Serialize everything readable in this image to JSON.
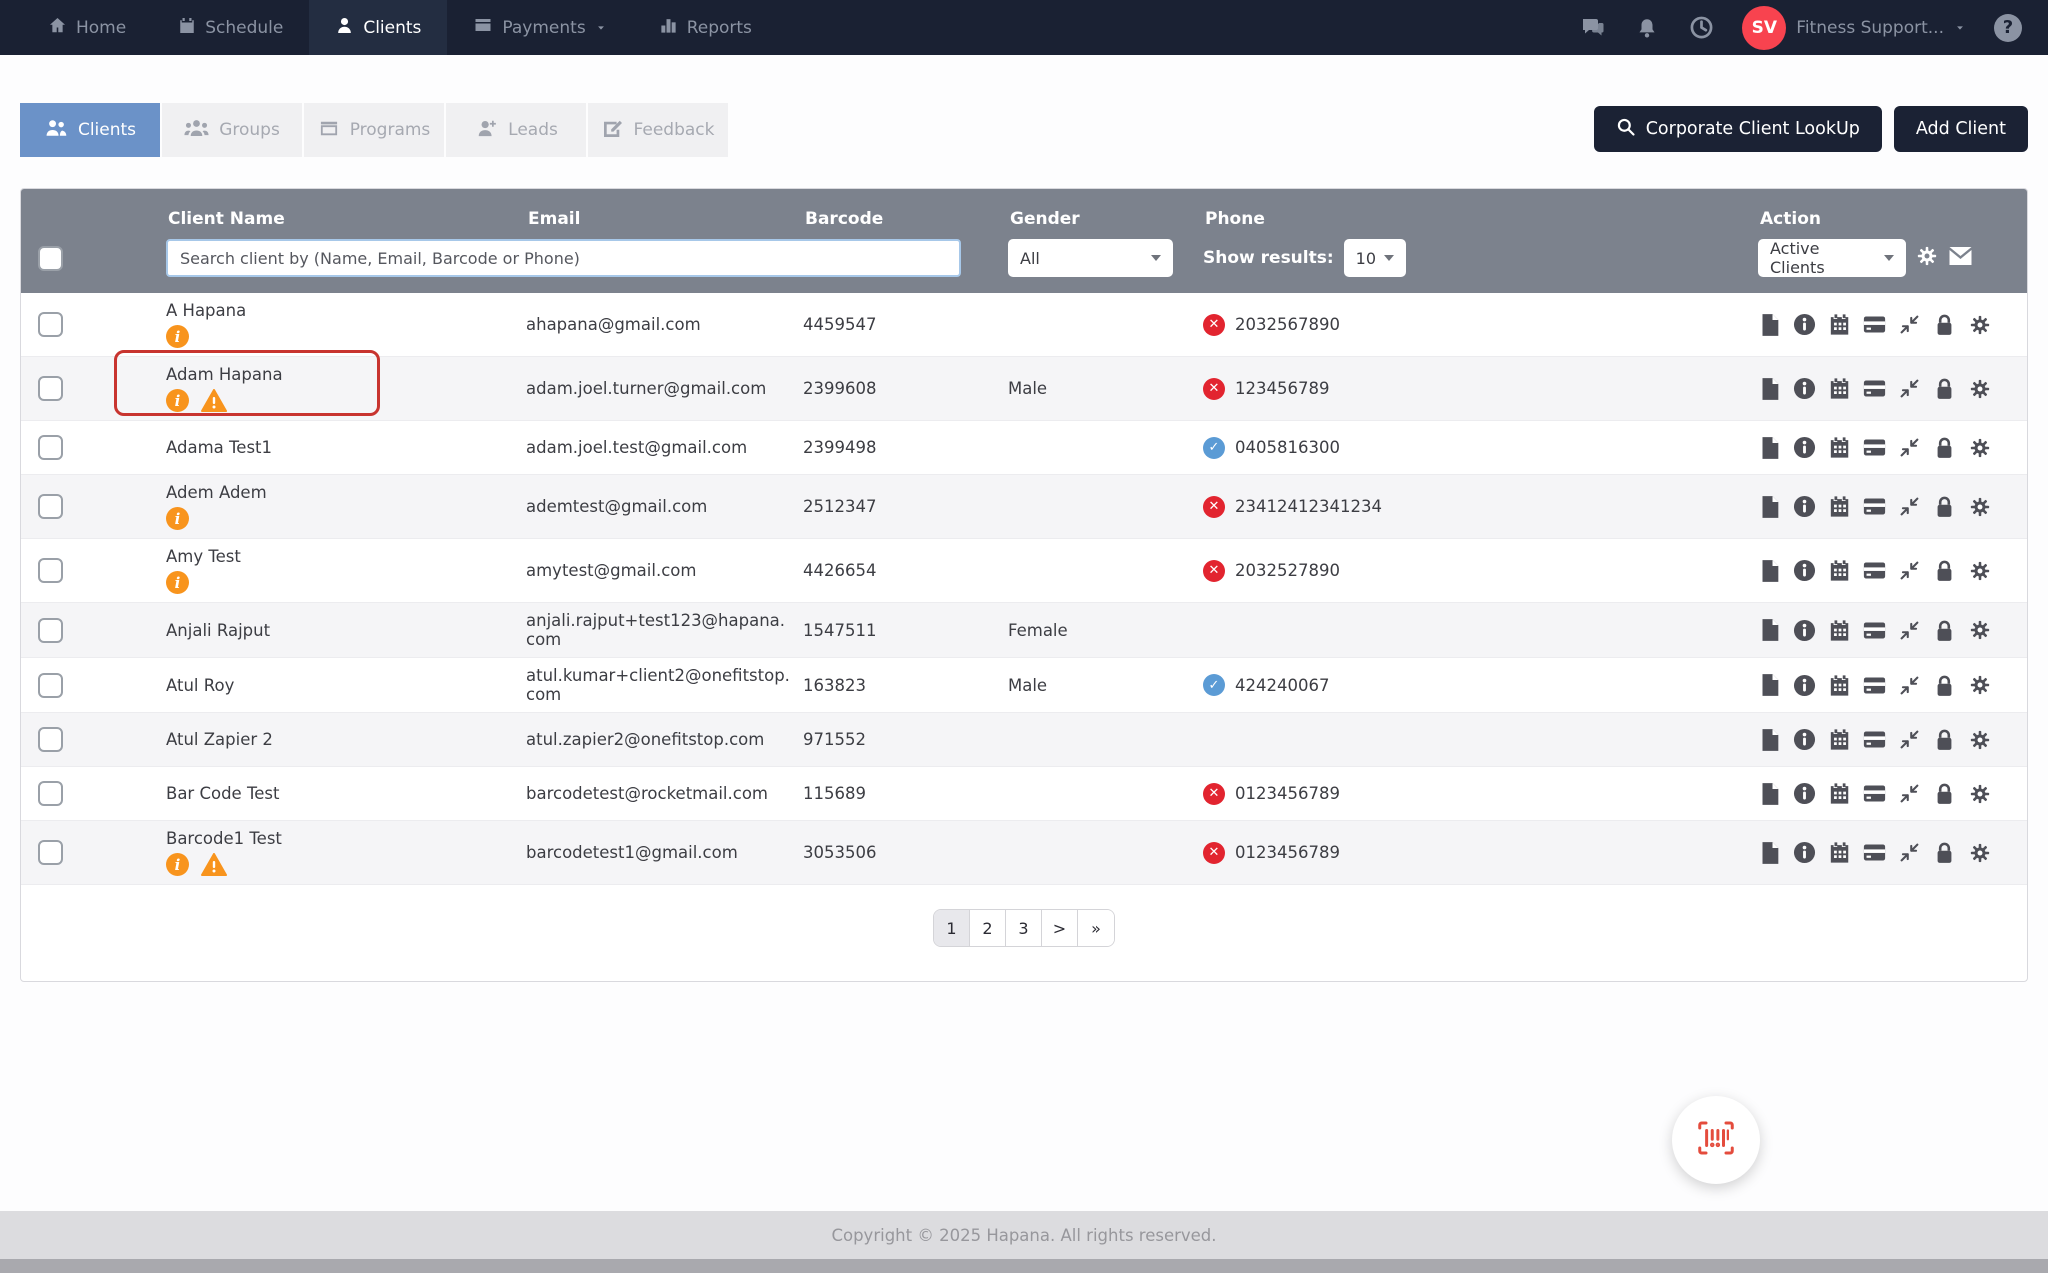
{
  "navbar": {
    "items": [
      {
        "label": "Home",
        "icon": "home-icon",
        "active": false
      },
      {
        "label": "Schedule",
        "icon": "schedule-icon",
        "active": false
      },
      {
        "label": "Clients",
        "icon": "clients-icon",
        "active": true
      },
      {
        "label": "Payments",
        "icon": "payments-icon",
        "active": false,
        "has_caret": true
      },
      {
        "label": "Reports",
        "icon": "reports-icon",
        "active": false
      }
    ],
    "right": {
      "avatar_initials": "SV",
      "account_name": "Fitness Support..."
    }
  },
  "tabs": [
    {
      "label": "Clients",
      "icon": "clients-tab-icon",
      "active": true
    },
    {
      "label": "Groups",
      "icon": "groups-tab-icon",
      "active": false
    },
    {
      "label": "Programs",
      "icon": "programs-tab-icon",
      "active": false
    },
    {
      "label": "Leads",
      "icon": "leads-tab-icon",
      "active": false
    },
    {
      "label": "Feedback",
      "icon": "feedback-tab-icon",
      "active": false
    }
  ],
  "toolbar": {
    "corporate_lookup_label": "Corporate Client LookUp",
    "add_client_label": "Add Client"
  },
  "table": {
    "headers": {
      "client_name": "Client Name",
      "email": "Email",
      "barcode": "Barcode",
      "gender": "Gender",
      "phone": "Phone",
      "action": "Action"
    },
    "filters": {
      "search_placeholder": "Search client by (Name, Email, Barcode or Phone)",
      "gender_value": "All",
      "show_results_label": "Show results:",
      "show_results_value": "10",
      "action_filter_value": "Active Clients"
    },
    "row_actions": [
      "file-icon",
      "info-circle-icon",
      "calendar-icon",
      "credit-card-icon",
      "compress-icon",
      "lock-icon",
      "gear-icon"
    ],
    "rows": [
      {
        "name": "A Hapana",
        "info": true,
        "warning": false,
        "highlighted": false,
        "email": "ahapana@gmail.com",
        "barcode": "4459547",
        "gender": "",
        "phone": "2032567890",
        "phone_status": "invalid"
      },
      {
        "name": "Adam Hapana",
        "info": true,
        "warning": true,
        "highlighted": true,
        "email": "adam.joel.turner@gmail.com",
        "barcode": "2399608",
        "gender": "Male",
        "phone": "123456789",
        "phone_status": "invalid"
      },
      {
        "name": "Adama Test1",
        "info": false,
        "warning": false,
        "highlighted": false,
        "email": "adam.joel.test@gmail.com",
        "barcode": "2399498",
        "gender": "",
        "phone": "0405816300",
        "phone_status": "verified"
      },
      {
        "name": "Adem Adem",
        "info": true,
        "warning": false,
        "highlighted": false,
        "email": "ademtest@gmail.com",
        "barcode": "2512347",
        "gender": "",
        "phone": "23412412341234",
        "phone_status": "invalid"
      },
      {
        "name": "Amy Test",
        "info": true,
        "warning": false,
        "highlighted": false,
        "email": "amytest@gmail.com",
        "barcode": "4426654",
        "gender": "",
        "phone": "2032527890",
        "phone_status": "invalid"
      },
      {
        "name": "Anjali Rajput",
        "info": false,
        "warning": false,
        "highlighted": false,
        "email": "anjali.rajput+test123@hapana.com",
        "barcode": "1547511",
        "gender": "Female",
        "phone": "",
        "phone_status": ""
      },
      {
        "name": "Atul Roy",
        "info": false,
        "warning": false,
        "highlighted": false,
        "email": "atul.kumar+client2@onefitstop.com",
        "barcode": "163823",
        "gender": "Male",
        "phone": "424240067",
        "phone_status": "verified"
      },
      {
        "name": "Atul Zapier 2",
        "info": false,
        "warning": false,
        "highlighted": false,
        "email": "atul.zapier2@onefitstop.com",
        "barcode": "971552",
        "gender": "",
        "phone": "",
        "phone_status": ""
      },
      {
        "name": "Bar Code Test",
        "info": false,
        "warning": false,
        "highlighted": false,
        "email": "barcodetest@rocketmail.com",
        "barcode": "115689",
        "gender": "",
        "phone": "0123456789",
        "phone_status": "invalid"
      },
      {
        "name": "Barcode1 Test",
        "info": true,
        "warning": true,
        "highlighted": false,
        "email": "barcodetest1@gmail.com",
        "barcode": "3053506",
        "gender": "",
        "phone": "0123456789",
        "phone_status": "invalid"
      }
    ]
  },
  "pagination": {
    "items": [
      "1",
      "2",
      "3",
      ">",
      "»"
    ],
    "active": "1"
  },
  "footer": {
    "copyright": "Copyright © 2025 Hapana. All rights reserved."
  },
  "colors": {
    "navbar_bg": "#1a2133",
    "active_tab_blue": "#6b92c8",
    "header_gray": "#7c828d",
    "avatar_red": "#f8434f",
    "invalid_red": "#e2242f",
    "verified_blue": "#5b9bd5",
    "warning_orange": "#f8941d",
    "highlight_red": "#c8342f",
    "barcode_icon_red": "#e44c3d"
  }
}
